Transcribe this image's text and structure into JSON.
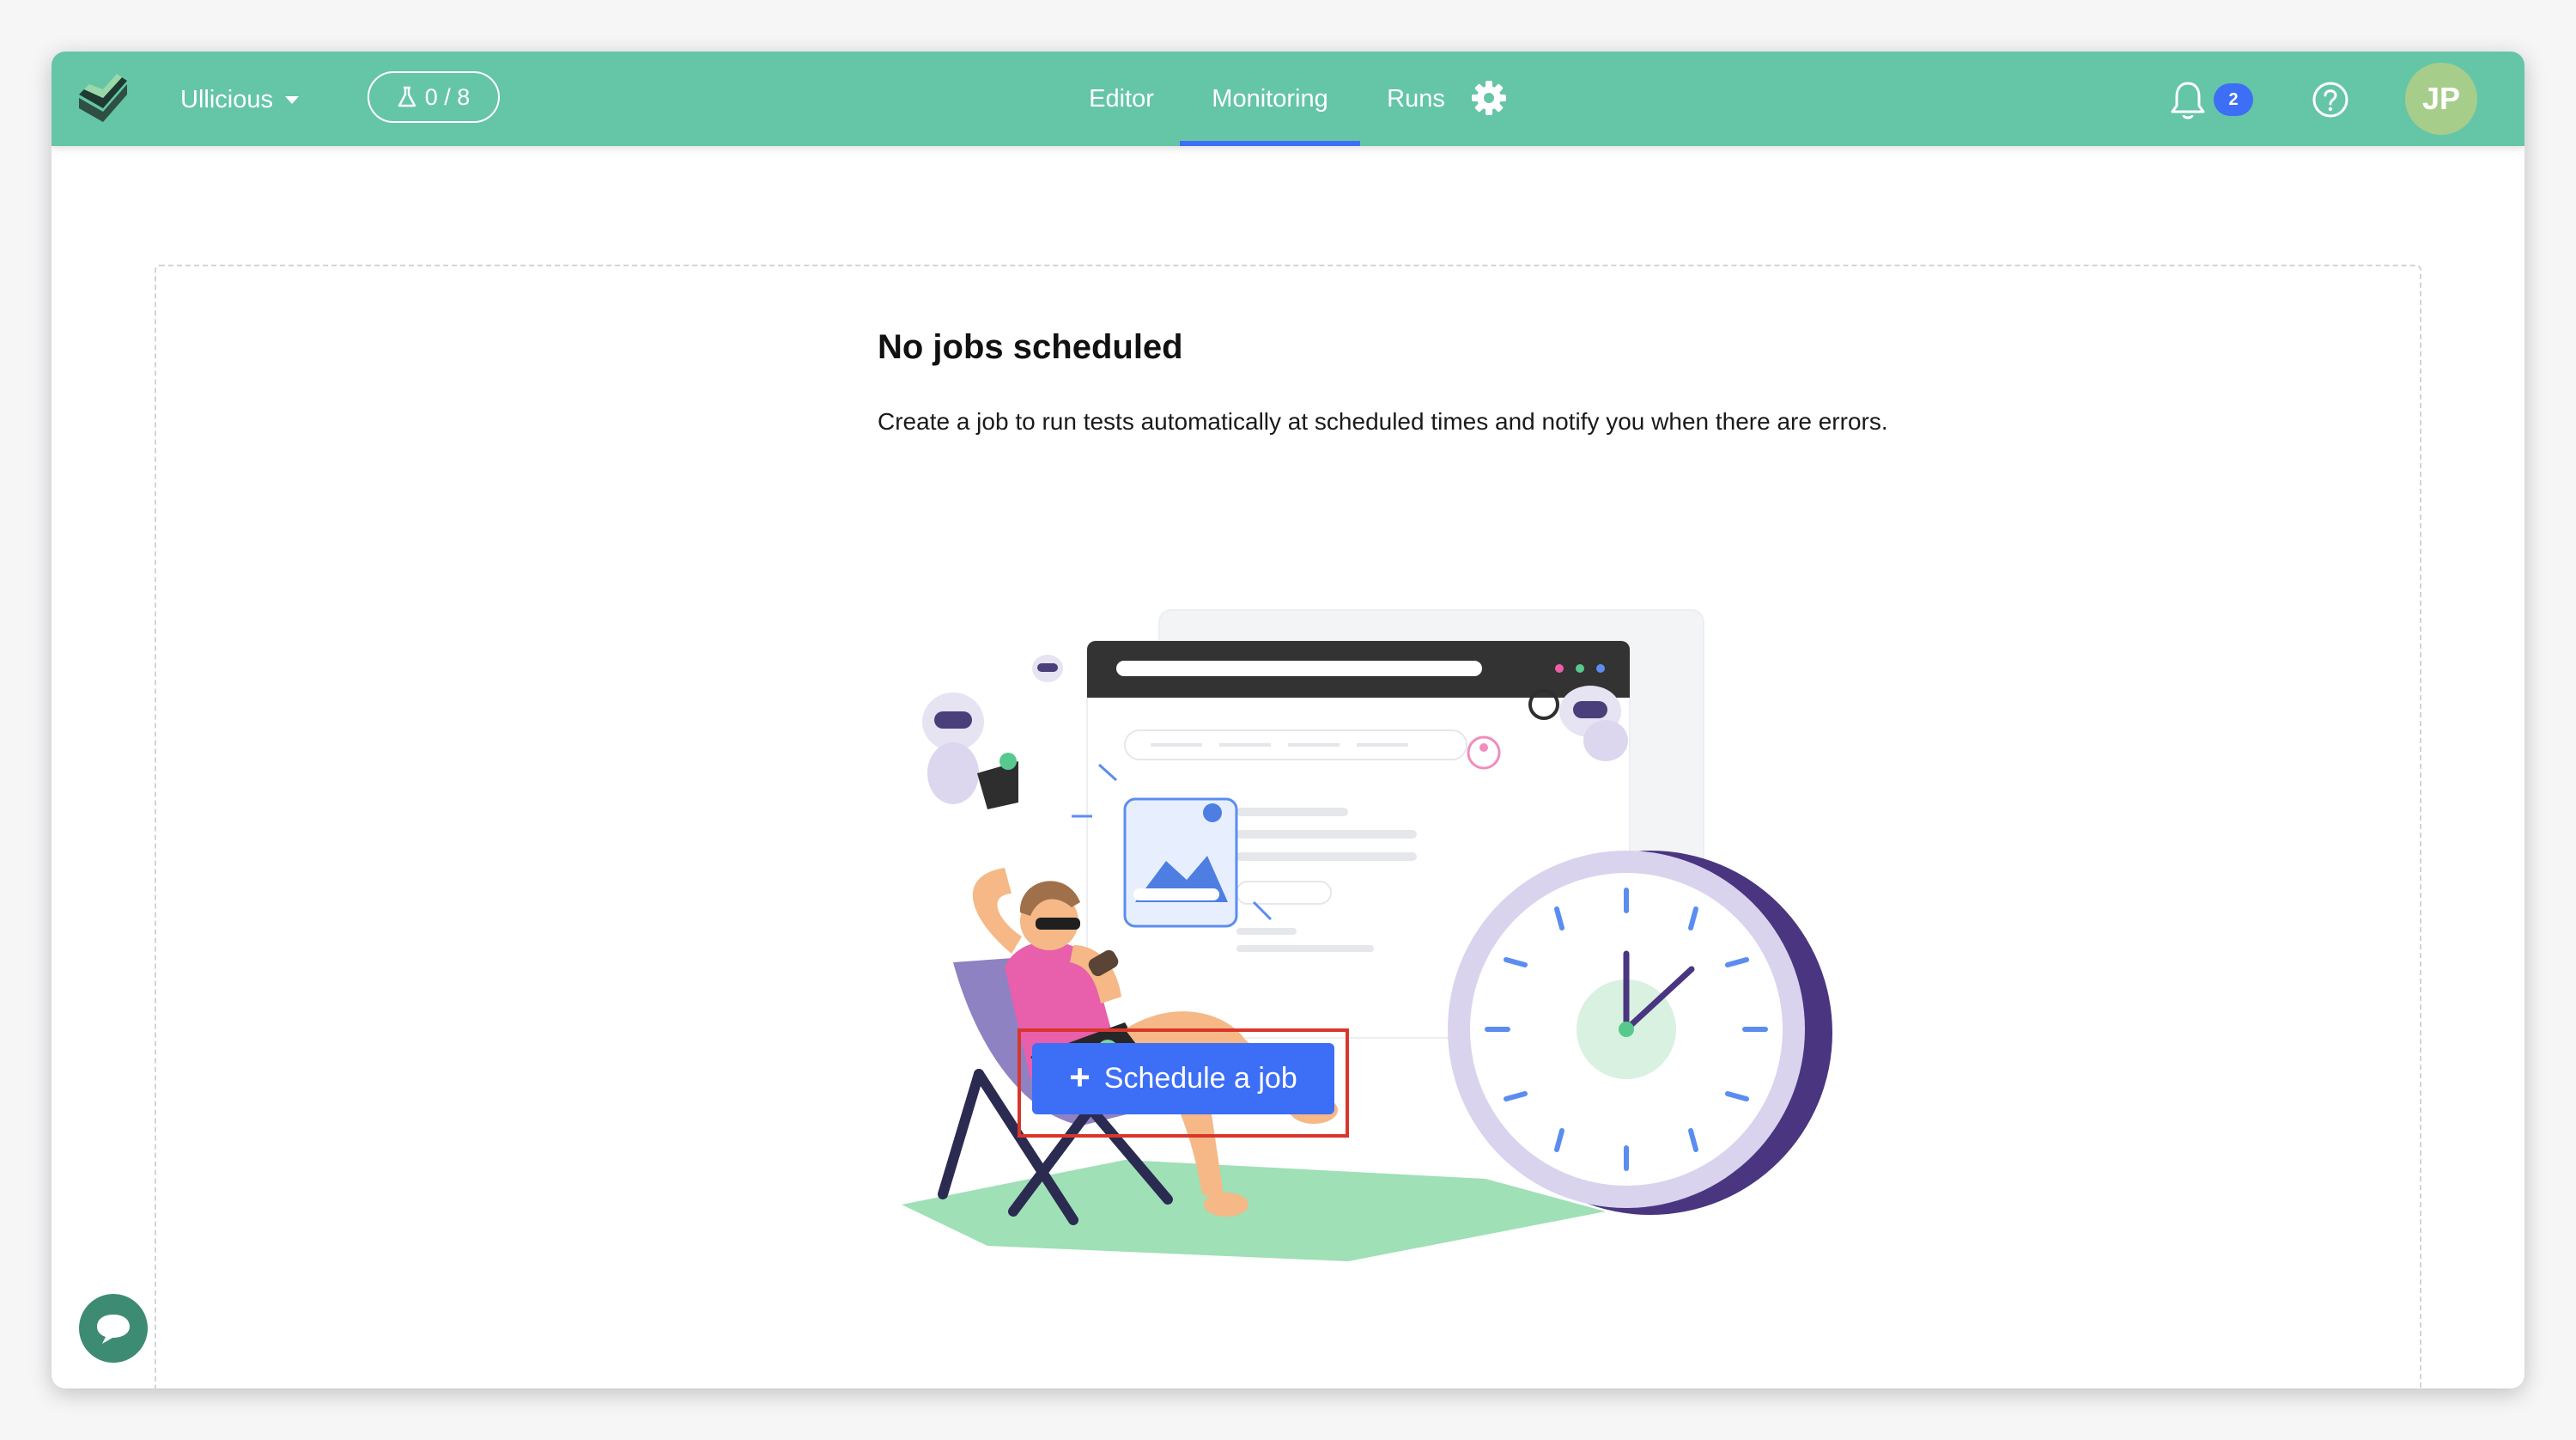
{
  "header": {
    "project_name": "Ullicious",
    "test_counter": "0 / 8",
    "notification_count": "2",
    "avatar_initials": "JP",
    "tabs": [
      {
        "label": "Editor",
        "active": false
      },
      {
        "label": "Monitoring",
        "active": true
      },
      {
        "label": "Runs",
        "active": false
      }
    ]
  },
  "main": {
    "title": "No jobs scheduled",
    "description": "Create a job to run tests automatically at scheduled times and notify you when there are errors.",
    "schedule_button": "Schedule a job"
  },
  "icons": {
    "logo": "checkmark-logo-icon",
    "counter": "flask-icon",
    "settings": "gear-icon",
    "notifications": "bell-icon",
    "help": "question-circle-icon",
    "chat": "chat-bubble-icon",
    "add": "plus-icon"
  },
  "colors": {
    "header_bg": "#65c5a7",
    "active_tab_underline": "#3d6ef6",
    "primary_button": "#3d6ef6",
    "notification_badge": "#3d6ef6",
    "avatar_bg": "#a7cd8b",
    "chat_button": "#3e8b73",
    "highlight_box": "#d9362b"
  }
}
